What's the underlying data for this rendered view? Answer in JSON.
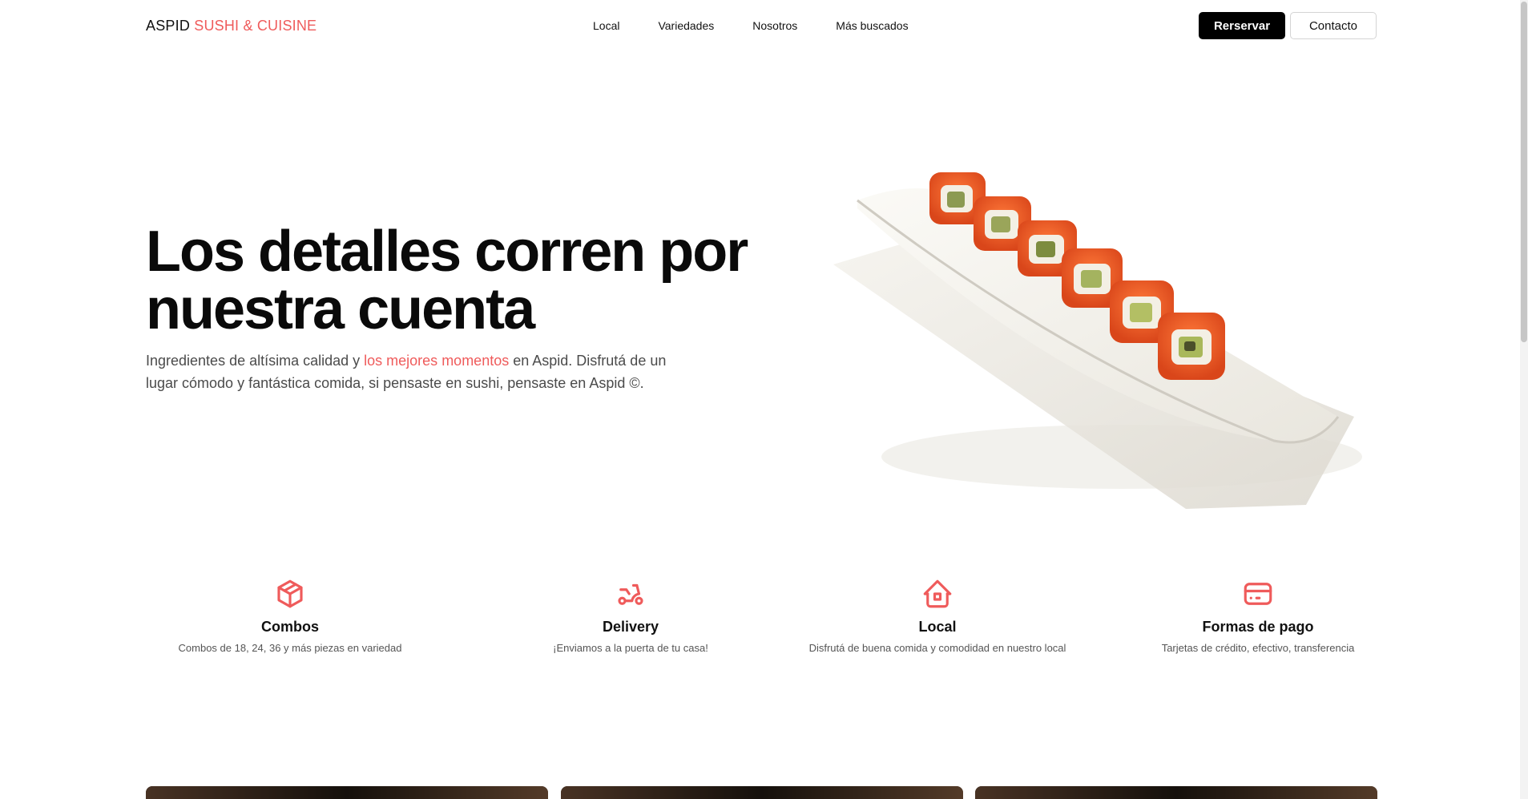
{
  "nav": {
    "brand_main": "ASPID",
    "brand_accent": "SUSHI & CUISINE",
    "links": [
      "Local",
      "Variedades",
      "Nosotros",
      "Más buscados"
    ],
    "reserve_label": "Rerservar",
    "contact_label": "Contacto"
  },
  "hero": {
    "title_line1": "Los detalles corren por",
    "title_line2": "nuestra cuenta",
    "sub_pre": "Ingredientes de altísima calidad y ",
    "sub_highlight": "los mejores momentos",
    "sub_post": " en Aspid. Disfrutá de un lugar cómodo y fantástica comida, si pensaste en sushi, pensaste en Aspid ©."
  },
  "features": [
    {
      "icon": "box-icon",
      "title": "Combos",
      "desc": "Combos de 18, 24, 36 y más piezas en variedad"
    },
    {
      "icon": "scooter-icon",
      "title": "Delivery",
      "desc": "¡Enviamos a la puerta de tu casa!"
    },
    {
      "icon": "home-icon",
      "title": "Local",
      "desc": "Disfrutá de buena comida y comodidad en nuestro local"
    },
    {
      "icon": "credit-card-icon",
      "title": "Formas de pago",
      "desc": "Tarjetas de crédito, efectivo, transferencia"
    }
  ],
  "colors": {
    "accent": "#ef5b5b",
    "primary_button": "#000000"
  }
}
